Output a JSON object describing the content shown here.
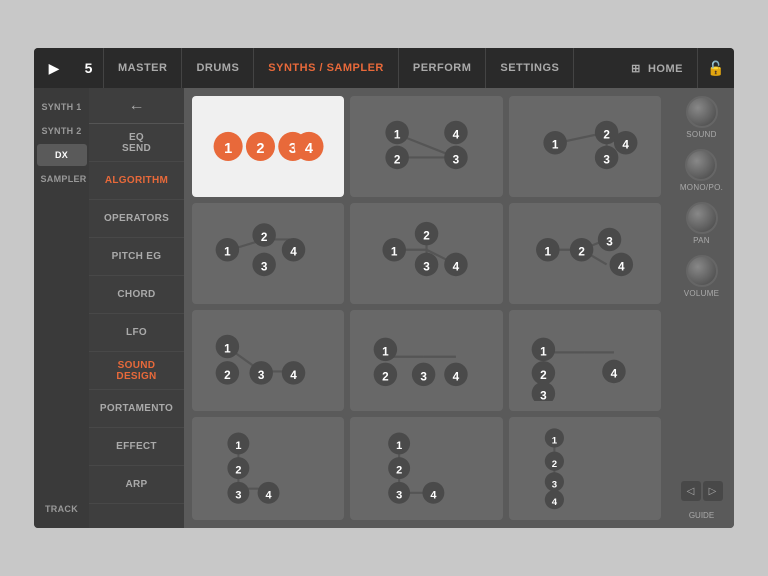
{
  "nav": {
    "play_icon": "▶",
    "number": "5",
    "items": [
      {
        "label": "MASTER",
        "active": false
      },
      {
        "label": "DRUMS",
        "active": false
      },
      {
        "label": "SYNTHS / SAMPLER",
        "active": true
      },
      {
        "label": "PERFORM",
        "active": false
      },
      {
        "label": "SETTINGS",
        "active": false
      },
      {
        "label": "⊞  HOME",
        "active": false
      }
    ],
    "lock_icon": "🔓"
  },
  "sidebar": {
    "items": [
      {
        "label": "SYNTH 1",
        "active": false
      },
      {
        "label": "SYNTH 2",
        "active": false
      },
      {
        "label": "DX",
        "active": true
      },
      {
        "label": "SAMPLER",
        "active": false
      },
      {
        "label": "TRACK",
        "active": false
      }
    ]
  },
  "middle_menu": {
    "back_icon": "←",
    "items": [
      {
        "label": "EQ\nSEND",
        "active": false
      },
      {
        "label": "ALGORITHM",
        "active": true,
        "orange": true
      },
      {
        "label": "OPERATORS",
        "active": false
      },
      {
        "label": "PITCH EG",
        "active": false
      },
      {
        "label": "CHORD",
        "active": false
      },
      {
        "label": "LFO",
        "active": false
      },
      {
        "label": "SOUND\nDESIGN",
        "active": false,
        "orange": true
      },
      {
        "label": "PORTAMENTO",
        "active": false
      },
      {
        "label": "EFFECT",
        "active": false
      },
      {
        "label": "ARP",
        "active": false
      }
    ]
  },
  "right_panel": {
    "knobs": [
      {
        "label": "SOUND"
      },
      {
        "label": "MONO/PO."
      },
      {
        "label": "PAN"
      },
      {
        "label": "VOLUME"
      }
    ],
    "guide": "GUIDE"
  },
  "accent_color": "#e8693a"
}
